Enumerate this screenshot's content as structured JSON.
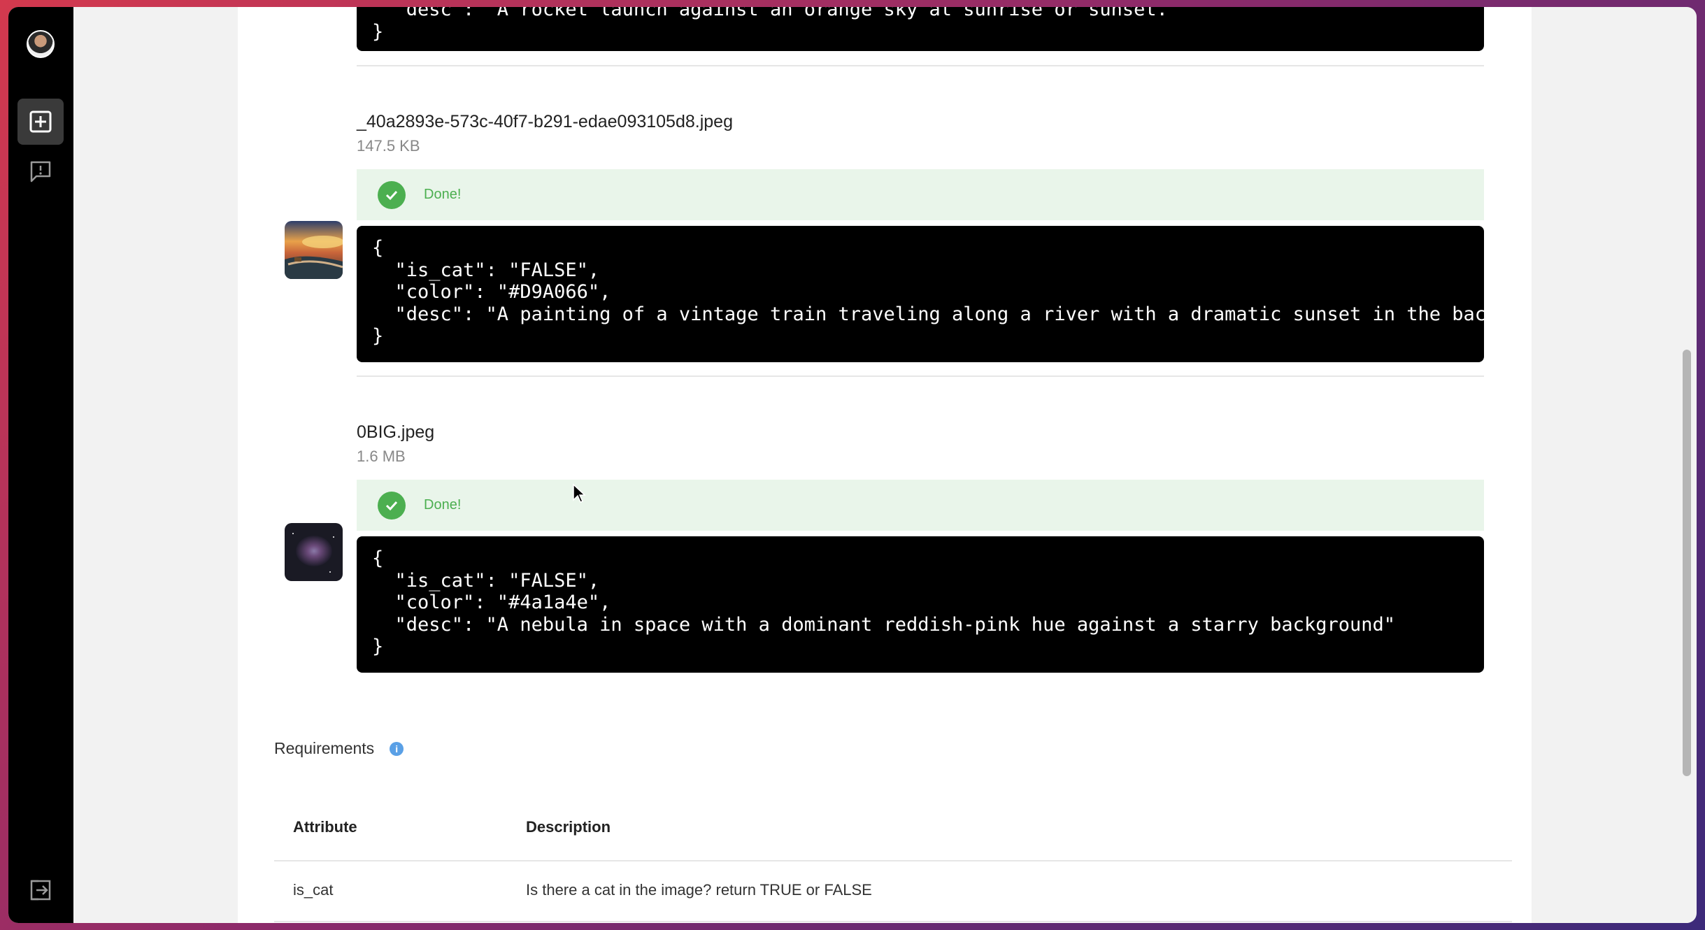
{
  "sidebar": {
    "avatar_icon": "user-avatar",
    "items": [
      {
        "icon": "add-square-icon",
        "active": true
      },
      {
        "icon": "feedback-icon",
        "active": false
      }
    ],
    "logout_icon": "logout-icon"
  },
  "top_entry": {
    "desc_line": "  \"desc\": \"A rocket launch against an orange sky at sunrise or sunset.\"",
    "close_line": "}"
  },
  "entries": [
    {
      "filename": "_40a2893e-573c-40f7-b291-edae093105d8.jpeg",
      "size": "147.5 KB",
      "status": "Done!",
      "json_lines": [
        "{",
        "  \"is_cat\": \"FALSE\",",
        "  \"color\": \"#D9A066\",",
        "  \"desc\": \"A painting of a vintage train traveling along a river with a dramatic sunset in the back",
        "}"
      ]
    },
    {
      "filename": "0BIG.jpeg",
      "size": "1.6 MB",
      "status": "Done!",
      "json_lines": [
        "{",
        "  \"is_cat\": \"FALSE\",",
        "  \"color\": \"#4a1a4e\",",
        "  \"desc\": \"A nebula in space with a dominant reddish-pink hue against a starry background\"",
        "}"
      ]
    }
  ],
  "requirements": {
    "title": "Requirements",
    "info_icon": "info-icon",
    "headers": [
      "Attribute",
      "Description"
    ],
    "rows": [
      {
        "attribute": "is_cat",
        "description": "Is there a cat in the image? return TRUE or FALSE"
      }
    ]
  },
  "colors": {
    "success": "#4caf50",
    "success_bg": "#e9f5ea",
    "code_bg": "#000000",
    "sidebar_bg": "#000000"
  }
}
